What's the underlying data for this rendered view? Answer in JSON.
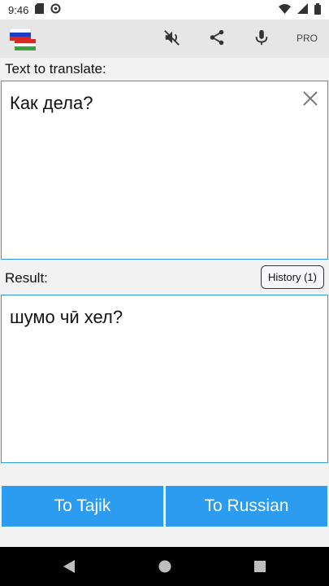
{
  "status_bar": {
    "time": "9:46"
  },
  "app_bar": {
    "pro_label": "PRO"
  },
  "input": {
    "label": "Text to translate:",
    "text": "Как дела?"
  },
  "result": {
    "label": "Result:",
    "text": "шумо чӣ хел?",
    "history_label": "History (1)"
  },
  "actions": {
    "to_tajik": "To Tajik",
    "to_russian": "To Russian"
  },
  "colors": {
    "accent": "#2b9cf0",
    "border": "#2b9ae8"
  }
}
